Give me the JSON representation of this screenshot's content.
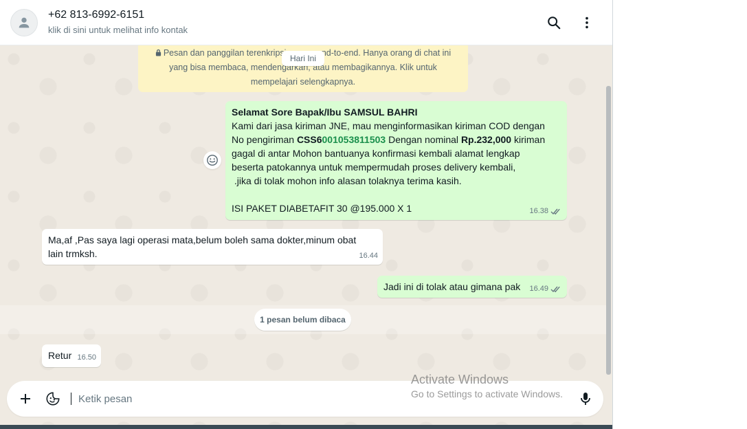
{
  "header": {
    "contact_name": "+62 813-6992-6151",
    "contact_subtitle": "klik di sini untuk melihat info kontak",
    "avatar_icon": "person-icon",
    "search_icon": "search-icon",
    "menu_icon": "kebab-menu-icon"
  },
  "chat": {
    "encryption_notice_1": "Pesan dan panggilan terenkripsi secara end-to-end. Hanya orang di chat ini",
    "encryption_notice_2": "yang bisa membaca, mendengarkan, atau membagikannya. Klik untuk",
    "encryption_notice_3": "mempelajari selengkapnya.",
    "day_label": "Hari Ini",
    "unread_label": "1 pesan belum dibaca",
    "messages": [
      {
        "direction": "out",
        "greeting": "Selamat Sore Bapak/Ibu SAMSUL BAHRI",
        "line2": "Kami dari jasa kiriman JNE, mau menginformasikan kiriman COD dengan",
        "line3_pre": "No pengiriman ",
        "awb_prefix": "CSS6",
        "awb_number": "001053811503",
        "line3_mid": " Dengan nominal ",
        "amount": "Rp.232,000",
        "line3_post": " kiriman",
        "line4": "gagal di antar Mohon bantuanya konfirmasi kembali alamat lengkap",
        "line5": "beserta patokannya untuk mempermudah proses delivery kembali,",
        "line6": " .jika di tolak mohon info alasan tolaknya terima kasih.",
        "line7": "ISI PAKET DIABETAFIT 30 @195.000 X 1",
        "time": "16.38",
        "status": "read"
      },
      {
        "direction": "in",
        "line1": "Ma,af ,Pas saya lagi operasi mata,belum boleh sama dokter,minum obat",
        "line2": "lain trmksh.",
        "time": "16.44"
      },
      {
        "direction": "out",
        "text": "Jadi ini di tolak atau gimana pak",
        "time": "16.49",
        "status": "read"
      },
      {
        "direction": "in",
        "text": "Retur",
        "time": "16.50"
      }
    ]
  },
  "composer": {
    "placeholder": "Ketik pesan",
    "attach_icon": "plus-icon",
    "sticker_icon": "sticker-icon",
    "mic_icon": "microphone-icon"
  },
  "watermark": {
    "title": "Activate Windows",
    "subtitle": "Go to Settings to activate Windows."
  },
  "colors": {
    "outgoing_bubble": "#d9fdd3",
    "incoming_bubble": "#ffffff",
    "chat_background": "#efeae2",
    "notice_background": "#fdf4c5",
    "awb_number_color": "#1a8f4c"
  }
}
